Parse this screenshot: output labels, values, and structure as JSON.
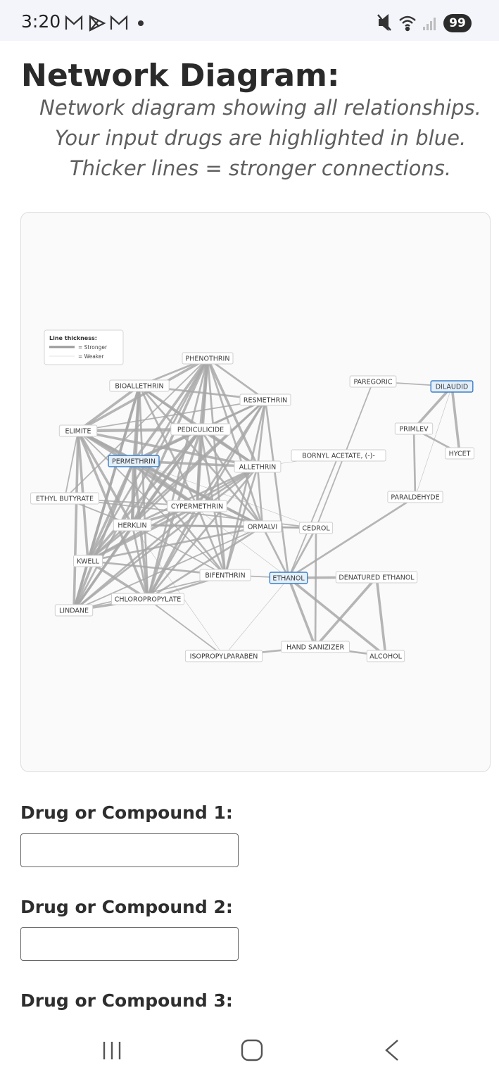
{
  "status_bar": {
    "time": "3:20",
    "battery": "99",
    "left_icons": [
      "gmail-icon",
      "play-icon",
      "gmail-icon",
      "dot-icon"
    ],
    "right_icons": [
      "mute-icon",
      "wifi-icon",
      "signal-icon"
    ]
  },
  "page": {
    "title": "Network Diagram:",
    "subtitle_lines": [
      "Network diagram showing all relationships.",
      "Your input drugs are highlighted in blue.",
      "Thicker lines = stronger connections."
    ]
  },
  "legend": {
    "title": "Line thickness:",
    "stronger": "= Stronger",
    "weaker": "= Weaker"
  },
  "colors": {
    "highlight_border": "#3d7fc4",
    "highlight_fill": "#e3effb",
    "highlight_text": "#2e6fb5",
    "edge": "#a8a8a8"
  },
  "network": {
    "nodes": [
      {
        "id": "PHENOTHRIN",
        "highlighted": false
      },
      {
        "id": "BIOALLETHRIN",
        "highlighted": false
      },
      {
        "id": "RESMETHRIN",
        "highlighted": false
      },
      {
        "id": "PAREGORIC",
        "highlighted": false
      },
      {
        "id": "DILAUDID",
        "highlighted": true
      },
      {
        "id": "ELIMITE",
        "highlighted": false
      },
      {
        "id": "PEDICULICIDE",
        "highlighted": false
      },
      {
        "id": "PRIMLEV",
        "highlighted": false
      },
      {
        "id": "HYCET",
        "highlighted": false
      },
      {
        "id": "PERMETHRIN",
        "highlighted": true
      },
      {
        "id": "ALLETHRIN",
        "highlighted": false
      },
      {
        "id": "BORNYL ACETATE, (-)-",
        "highlighted": false
      },
      {
        "id": "PARALDEHYDE",
        "highlighted": false
      },
      {
        "id": "ETHYL BUTYRATE",
        "highlighted": false
      },
      {
        "id": "CYPERMETHRIN",
        "highlighted": false
      },
      {
        "id": "HERKLIN",
        "highlighted": false
      },
      {
        "id": "ORMALVI",
        "highlighted": false
      },
      {
        "id": "CEDROL",
        "highlighted": false
      },
      {
        "id": "KWELL",
        "highlighted": false
      },
      {
        "id": "BIFENTHRIN",
        "highlighted": false
      },
      {
        "id": "ETHANOL",
        "highlighted": true
      },
      {
        "id": "DENATURED ETHANOL",
        "highlighted": false
      },
      {
        "id": "CHLOROPROPYLATE",
        "highlighted": false
      },
      {
        "id": "LINDANE",
        "highlighted": false
      },
      {
        "id": "HAND SANIZIZER",
        "highlighted": false
      },
      {
        "id": "ISOPROPYLPARABEN",
        "highlighted": false
      },
      {
        "id": "ALCOHOL",
        "highlighted": false
      }
    ],
    "edges": [
      [
        "PAREGORIC",
        "DILAUDID",
        2
      ],
      [
        "DILAUDID",
        "PRIMLEV",
        4
      ],
      [
        "DILAUDID",
        "HYCET",
        4
      ],
      [
        "DILAUDID",
        "PARALDEHYDE",
        1
      ],
      [
        "PRIMLEV",
        "HYCET",
        3
      ],
      [
        "PRIMLEV",
        "PARALDEHYDE",
        3
      ],
      [
        "PARALDEHYDE",
        "ETHANOL",
        3
      ],
      [
        "PAREGORIC",
        "CEDROL",
        2
      ],
      [
        "BORNYL ACETATE, (-)-",
        "ALLETHRIN",
        1
      ],
      [
        "BORNYL ACETATE, (-)-",
        "ETHANOL",
        2
      ],
      [
        "ETHANOL",
        "DENATURED ETHANOL",
        4
      ],
      [
        "ETHANOL",
        "HAND SANIZIZER",
        4
      ],
      [
        "ETHANOL",
        "ALCOHOL",
        4
      ],
      [
        "ETHANOL",
        "CEDROL",
        3
      ],
      [
        "ETHANOL",
        "ISOPROPYLPARABEN",
        1
      ],
      [
        "ETHANOL",
        "BIFENTHRIN",
        2
      ],
      [
        "ETHANOL",
        "RESMETHRIN",
        3
      ],
      [
        "ETHANOL",
        "ORMALVI",
        3
      ],
      [
        "DENATURED ETHANOL",
        "HAND SANIZIZER",
        4
      ],
      [
        "DENATURED ETHANOL",
        "ALCOHOL",
        4
      ],
      [
        "HAND SANIZIZER",
        "ALCOHOL",
        3
      ],
      [
        "HAND SANIZIZER",
        "ISOPROPYLPARABEN",
        3
      ],
      [
        "CEDROL",
        "HAND SANIZIZER",
        3
      ],
      [
        "ISOPROPYLPARABEN",
        "CHLOROPROPYLATE",
        2
      ],
      [
        "ISOPROPYLPARABEN",
        "HERKLIN",
        1
      ],
      [
        "PHENOTHRIN",
        "BIOALLETHRIN",
        3
      ],
      [
        "PHENOTHRIN",
        "RESMETHRIN",
        3
      ],
      [
        "PHENOTHRIN",
        "ELIMITE",
        4
      ],
      [
        "PHENOTHRIN",
        "PEDICULICIDE",
        5
      ],
      [
        "PHENOTHRIN",
        "PERMETHRIN",
        4
      ],
      [
        "PHENOTHRIN",
        "ALLETHRIN",
        4
      ],
      [
        "PHENOTHRIN",
        "CYPERMETHRIN",
        4
      ],
      [
        "PHENOTHRIN",
        "HERKLIN",
        4
      ],
      [
        "PHENOTHRIN",
        "ORMALVI",
        3
      ],
      [
        "PHENOTHRIN",
        "KWELL",
        3
      ],
      [
        "PHENOTHRIN",
        "BIFENTHRIN",
        3
      ],
      [
        "PHENOTHRIN",
        "CHLOROPROPYLATE",
        3
      ],
      [
        "PHENOTHRIN",
        "LINDANE",
        3
      ],
      [
        "PHENOTHRIN",
        "ETHYL BUTYRATE",
        2
      ],
      [
        "BIOALLETHRIN",
        "RESMETHRIN",
        3
      ],
      [
        "BIOALLETHRIN",
        "ELIMITE",
        4
      ],
      [
        "BIOALLETHRIN",
        "PEDICULICIDE",
        3
      ],
      [
        "BIOALLETHRIN",
        "PERMETHRIN",
        4
      ],
      [
        "BIOALLETHRIN",
        "ALLETHRIN",
        4
      ],
      [
        "BIOALLETHRIN",
        "CYPERMETHRIN",
        3
      ],
      [
        "BIOALLETHRIN",
        "HERKLIN",
        4
      ],
      [
        "BIOALLETHRIN",
        "KWELL",
        4
      ],
      [
        "BIOALLETHRIN",
        "LINDANE",
        4
      ],
      [
        "BIOALLETHRIN",
        "CHLOROPROPYLATE",
        3
      ],
      [
        "BIOALLETHRIN",
        "ORMALVI",
        3
      ],
      [
        "RESMETHRIN",
        "PEDICULICIDE",
        3
      ],
      [
        "RESMETHRIN",
        "PERMETHRIN",
        3
      ],
      [
        "RESMETHRIN",
        "ALLETHRIN",
        3
      ],
      [
        "RESMETHRIN",
        "CYPERMETHRIN",
        3
      ],
      [
        "RESMETHRIN",
        "HERKLIN",
        3
      ],
      [
        "RESMETHRIN",
        "KWELL",
        3
      ],
      [
        "RESMETHRIN",
        "BIFENTHRIN",
        3
      ],
      [
        "RESMETHRIN",
        "CHLOROPROPYLATE",
        3
      ],
      [
        "RESMETHRIN",
        "ELIMITE",
        2
      ],
      [
        "ELIMITE",
        "PEDICULICIDE",
        5
      ],
      [
        "ELIMITE",
        "PERMETHRIN",
        5
      ],
      [
        "ELIMITE",
        "ALLETHRIN",
        4
      ],
      [
        "ELIMITE",
        "CYPERMETHRIN",
        4
      ],
      [
        "ELIMITE",
        "HERKLIN",
        4
      ],
      [
        "ELIMITE",
        "ORMALVI",
        4
      ],
      [
        "ELIMITE",
        "KWELL",
        4
      ],
      [
        "ELIMITE",
        "LINDANE",
        4
      ],
      [
        "ELIMITE",
        "CHLOROPROPYLATE",
        4
      ],
      [
        "ELIMITE",
        "ETHYL BUTYRATE",
        2
      ],
      [
        "PEDICULICIDE",
        "PERMETHRIN",
        5
      ],
      [
        "PEDICULICIDE",
        "ALLETHRIN",
        4
      ],
      [
        "PEDICULICIDE",
        "CYPERMETHRIN",
        4
      ],
      [
        "PEDICULICIDE",
        "HERKLIN",
        4
      ],
      [
        "PEDICULICIDE",
        "KWELL",
        4
      ],
      [
        "PEDICULICIDE",
        "LINDANE",
        4
      ],
      [
        "PEDICULICIDE",
        "CHLOROPROPYLATE",
        4
      ],
      [
        "PEDICULICIDE",
        "BIFENTHRIN",
        3
      ],
      [
        "PEDICULICIDE",
        "ORMALVI",
        3
      ],
      [
        "PERMETHRIN",
        "ALLETHRIN",
        4
      ],
      [
        "PERMETHRIN",
        "CYPERMETHRIN",
        5
      ],
      [
        "PERMETHRIN",
        "HERKLIN",
        5
      ],
      [
        "PERMETHRIN",
        "ORMALVI",
        4
      ],
      [
        "PERMETHRIN",
        "KWELL",
        4
      ],
      [
        "PERMETHRIN",
        "LINDANE",
        4
      ],
      [
        "PERMETHRIN",
        "CHLOROPROPYLATE",
        4
      ],
      [
        "PERMETHRIN",
        "BIFENTHRIN",
        3
      ],
      [
        "PERMETHRIN",
        "ETHANOL",
        1
      ],
      [
        "PERMETHRIN",
        "CEDROL",
        1
      ],
      [
        "ALLETHRIN",
        "CYPERMETHRIN",
        3
      ],
      [
        "ALLETHRIN",
        "HERKLIN",
        3
      ],
      [
        "ALLETHRIN",
        "KWELL",
        3
      ],
      [
        "ALLETHRIN",
        "LINDANE",
        3
      ],
      [
        "ALLETHRIN",
        "CHLOROPROPYLATE",
        3
      ],
      [
        "ALLETHRIN",
        "BIFENTHRIN",
        3
      ],
      [
        "ALLETHRIN",
        "ORMALVI",
        3
      ],
      [
        "ETHYL BUTYRATE",
        "HERKLIN",
        2
      ],
      [
        "ETHYL BUTYRATE",
        "CEDROL",
        2
      ],
      [
        "ETHYL BUTYRATE",
        "CYPERMETHRIN",
        2
      ],
      [
        "CYPERMETHRIN",
        "HERKLIN",
        4
      ],
      [
        "CYPERMETHRIN",
        "ORMALVI",
        3
      ],
      [
        "CYPERMETHRIN",
        "KWELL",
        4
      ],
      [
        "CYPERMETHRIN",
        "LINDANE",
        3
      ],
      [
        "CYPERMETHRIN",
        "CHLOROPROPYLATE",
        4
      ],
      [
        "CYPERMETHRIN",
        "BIFENTHRIN",
        3
      ],
      [
        "HERKLIN",
        "ORMALVI",
        3
      ],
      [
        "HERKLIN",
        "KWELL",
        3
      ],
      [
        "HERKLIN",
        "LINDANE",
        3
      ],
      [
        "HERKLIN",
        "CHLOROPROPYLATE",
        3
      ],
      [
        "HERKLIN",
        "CEDROL",
        3
      ],
      [
        "HERKLIN",
        "BIFENTHRIN",
        2
      ],
      [
        "ORMALVI",
        "KWELL",
        3
      ],
      [
        "ORMALVI",
        "CHLOROPROPYLATE",
        3
      ],
      [
        "ORMALVI",
        "LINDANE",
        2
      ],
      [
        "ORMALVI",
        "CEDROL",
        2
      ],
      [
        "KWELL",
        "LINDANE",
        4
      ],
      [
        "KWELL",
        "CHLOROPROPYLATE",
        4
      ],
      [
        "KWELL",
        "BIFENTHRIN",
        3
      ],
      [
        "BIFENTHRIN",
        "CHLOROPROPYLATE",
        3
      ],
      [
        "BIFENTHRIN",
        "LINDANE",
        2
      ],
      [
        "CHLOROPROPYLATE",
        "LINDANE",
        4
      ],
      [
        "ELIMITE",
        "BIFENTHRIN",
        2
      ]
    ]
  },
  "form": {
    "fields": [
      {
        "label": "Drug or Compound 1:",
        "value": ""
      },
      {
        "label": "Drug or Compound 2:",
        "value": ""
      },
      {
        "label": "Drug or Compound 3:"
      }
    ]
  },
  "nav_bar": {
    "icons": [
      "recents-icon",
      "home-icon",
      "back-icon"
    ]
  }
}
